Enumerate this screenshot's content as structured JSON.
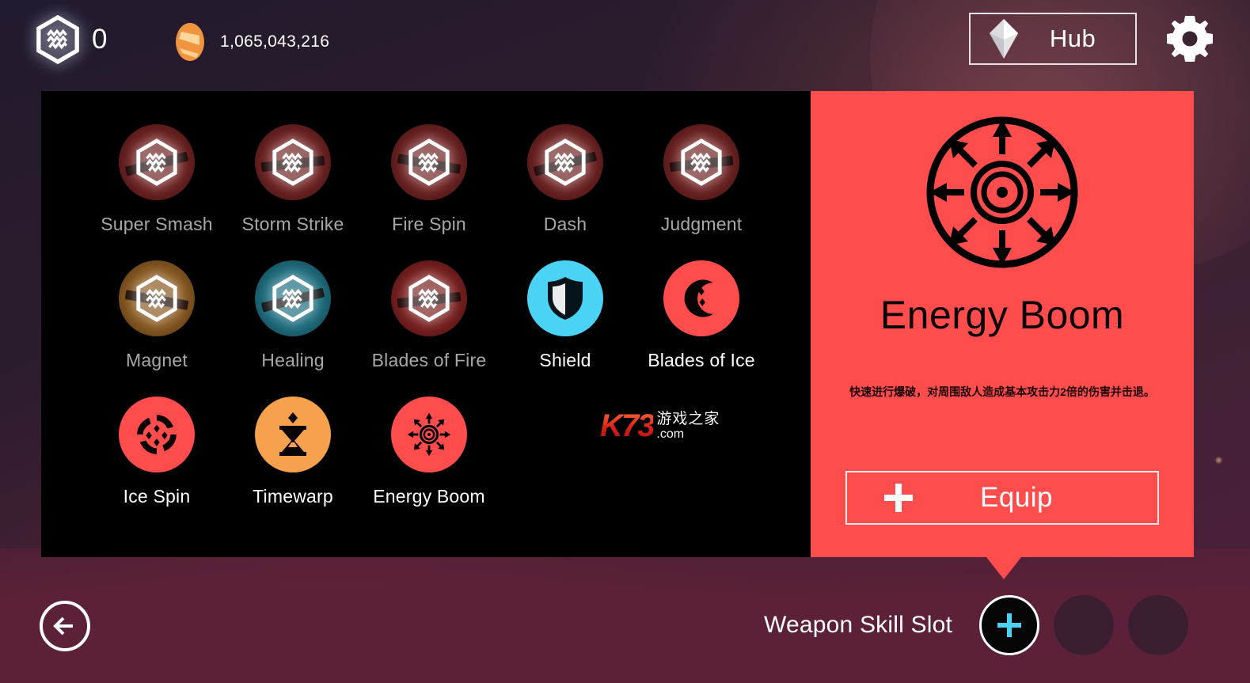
{
  "topbar": {
    "energy": {
      "icon": "hex-energy-icon",
      "value": "0"
    },
    "coin": {
      "icon": "coin-icon",
      "value": "1,065,043,216"
    },
    "hub": {
      "icon": "gem-icon",
      "label": "Hub"
    },
    "settings": {
      "icon": "gear-icon"
    }
  },
  "skills": [
    {
      "name": "Super Smash",
      "locked": true,
      "circle_color": "#6e2222",
      "icon": "locked-hex-icon"
    },
    {
      "name": "Storm Strike",
      "locked": true,
      "circle_color": "#6e2222",
      "icon": "locked-hex-icon"
    },
    {
      "name": "Fire Spin",
      "locked": true,
      "circle_color": "#6e2222",
      "icon": "locked-hex-icon"
    },
    {
      "name": "Dash",
      "locked": true,
      "circle_color": "#6e2222",
      "icon": "locked-hex-icon"
    },
    {
      "name": "Judgment",
      "locked": true,
      "circle_color": "#6e2222",
      "icon": "locked-hex-icon"
    },
    {
      "name": "Magnet",
      "locked": true,
      "circle_color": "#8a5a22",
      "icon": "locked-hex-icon"
    },
    {
      "name": "Healing",
      "locked": true,
      "circle_color": "#1f6f80",
      "icon": "locked-hex-icon"
    },
    {
      "name": "Blades of Fire",
      "locked": true,
      "circle_color": "#7a2020",
      "icon": "locked-hex-icon"
    },
    {
      "name": "Shield",
      "locked": false,
      "circle_color": "#4ad3f5",
      "icon": "shield-icon"
    },
    {
      "name": "Blades of Ice",
      "locked": false,
      "circle_color": "#ff4c4c",
      "icon": "ice-crescent-icon"
    },
    {
      "name": "Ice Spin",
      "locked": false,
      "circle_color": "#ff4c4c",
      "icon": "ice-spin-icon"
    },
    {
      "name": "Timewarp",
      "locked": false,
      "circle_color": "#f5a14e",
      "icon": "hourglass-icon"
    },
    {
      "name": "Energy Boom",
      "locked": false,
      "circle_color": "#ff4c4c",
      "icon": "energy-boom-icon"
    }
  ],
  "detail": {
    "icon": "energy-boom-icon",
    "title": "Energy Boom",
    "description": "快速进行爆破，对周围敌人造成基本攻击力2倍的伤害并击退。",
    "equip_label": "Equip",
    "equip_icon": "plus-icon",
    "panel_color": "#ff4c4c"
  },
  "bottom": {
    "back_icon": "arrow-left-icon",
    "slot_label": "Weapon Skill Slot",
    "slots": [
      {
        "state": "active",
        "icon": "plus-icon"
      },
      {
        "state": "empty",
        "icon": ""
      },
      {
        "state": "empty",
        "icon": ""
      }
    ]
  },
  "watermark": {
    "brand": "K73",
    "cn": "游戏之家",
    "tld": ".com"
  }
}
